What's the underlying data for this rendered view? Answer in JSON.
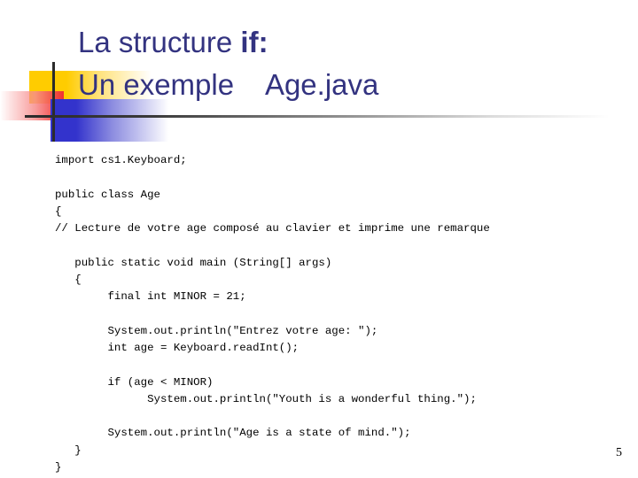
{
  "slide": {
    "title": {
      "line1_prefix": "La structure ",
      "line1_keyword": "if",
      "line1_suffix": ":",
      "line2": "Un exemple    Age.java"
    },
    "code": "import cs1.Keyboard;\n\npublic class Age\n{\n// Lecture de votre age composé au clavier et imprime une remarque\n\n   public static void main (String[] args)\n   {\n        final int MINOR = 21;\n\n        System.out.println(\"Entrez votre age: \");\n        int age = Keyboard.readInt();\n\n        if (age < MINOR)\n              System.out.println(\"Youth is a wonderful thing.\");\n\n        System.out.println(\"Age is a state of mind.\");\n   }\n}",
    "page_number": "5",
    "colors": {
      "title": "#333380",
      "accent_yellow": "#FFCC00",
      "accent_red": "#F03030",
      "accent_blue": "#3333CC",
      "rule": "#2B2B2B",
      "code_text": "#000000",
      "background": "#FFFFFF"
    }
  }
}
